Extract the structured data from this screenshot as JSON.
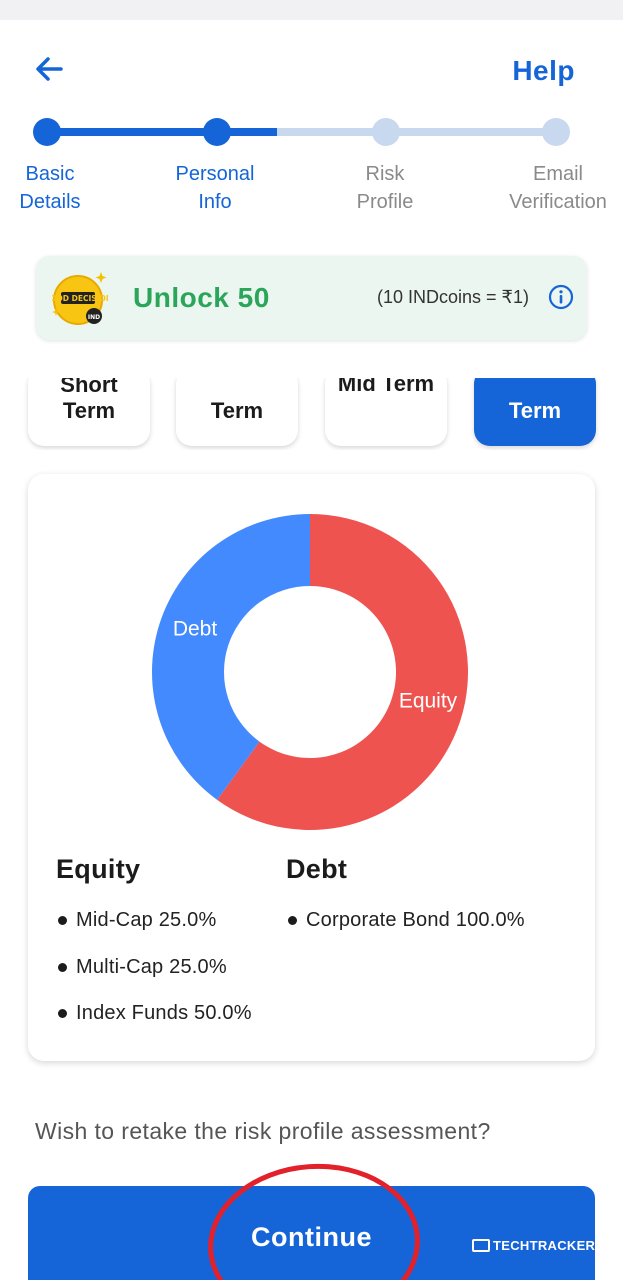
{
  "header": {
    "help_label": "Help"
  },
  "stepper": {
    "steps": [
      {
        "label": "Basic\nDetails",
        "state": "done"
      },
      {
        "label": "Personal\nInfo",
        "state": "current"
      },
      {
        "label": "Risk\nProfile",
        "state": "pending"
      },
      {
        "label": "Email\nVerification",
        "state": "pending"
      }
    ],
    "progress_fraction": 0.45,
    "colors": {
      "active": "#1565d8",
      "inactive": "#c8d8ef",
      "label_active": "#1565d8",
      "label_inactive": "#8a8a8a"
    }
  },
  "coins_banner": {
    "title": "Unlock 50",
    "rate": "(10 INDcoins = ₹1)",
    "logo_text": "GOOD DECISION",
    "logo_badge": "IND"
  },
  "terms": {
    "chips": [
      {
        "label": "Short\nTerm",
        "active": false
      },
      {
        "label": "Term",
        "active": false
      },
      {
        "label": "Mid Term",
        "active": false
      },
      {
        "label": "Term",
        "active": true
      }
    ]
  },
  "allocation": {
    "chart_data": {
      "type": "pie",
      "categories": [
        "Equity",
        "Debt"
      ],
      "values": [
        60,
        40
      ],
      "colors": [
        "#ef5350",
        "#448aff"
      ]
    },
    "columns": [
      {
        "title": "Equity",
        "items": [
          "Mid-Cap 25.0%",
          "Multi-Cap 25.0%",
          "Index Funds 50.0%"
        ]
      },
      {
        "title": "Debt",
        "items": [
          "Corporate Bond 100.0%"
        ]
      }
    ]
  },
  "retake_text": "Wish to retake the risk profile assessment?",
  "continue_label": "Continue",
  "watermark": "TECHTRACKER.IN"
}
